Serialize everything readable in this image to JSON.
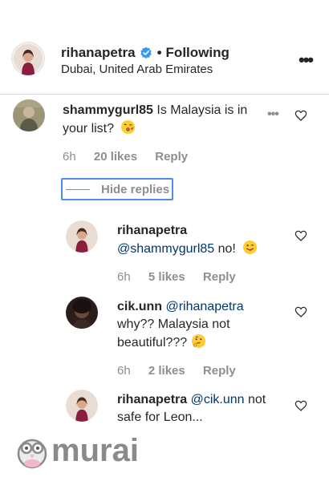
{
  "post_header": {
    "username": "rihanapetra",
    "separator": "•",
    "follow_status": "Following",
    "location": "Dubai, United Arab Emirates"
  },
  "comment": {
    "username": "shammygurl85",
    "text_line1": "Is Malaysia is in",
    "text_line2": "your list?",
    "more_icon": "…",
    "time": "6h",
    "likes": "20 likes",
    "reply_label": "Reply"
  },
  "hide_replies_label": "Hide replies",
  "replies": [
    {
      "username": "rihanapetra",
      "mention": "@shammygurl85",
      "text": "no!",
      "time": "6h",
      "likes": "5 likes",
      "reply_label": "Reply"
    },
    {
      "username": "cik.unn",
      "mention": "@rihanapetra",
      "text_line1": "why?? Malaysia not",
      "text_line2": "beautiful???",
      "time": "6h",
      "likes": "2 likes",
      "reply_label": "Reply"
    },
    {
      "username": "rihanapetra",
      "mention": "@cik.unn",
      "text_line1": "not",
      "text_line2": "safe for Leon..."
    }
  ],
  "watermark": {
    "text": "murai"
  },
  "colors": {
    "accent_blue": "#3897f0",
    "link_blue": "#00376b",
    "gray": "#8e8e8e",
    "focus_blue": "#4f8ee8",
    "watermark_gray": "#8a8a8a",
    "watermark_pink": "#f4b6cf"
  }
}
